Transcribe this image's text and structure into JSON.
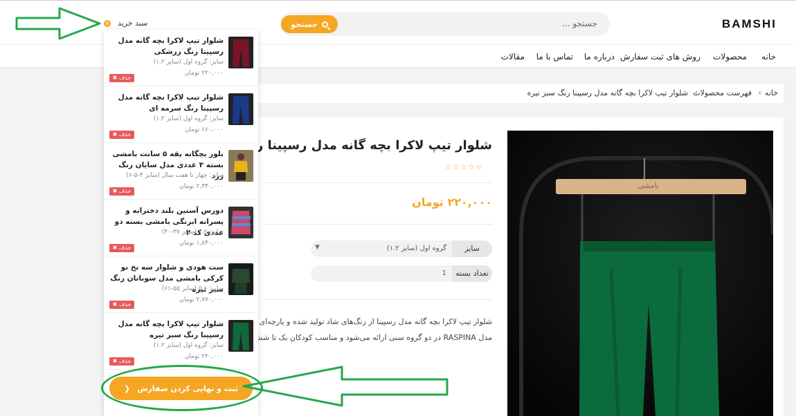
{
  "header": {
    "logo": "BAMSHI",
    "search_placeholder": "جستجو ...",
    "search_button": "جستجو",
    "cart_label": "سبد خرید",
    "cart_count": "6"
  },
  "nav": [
    "خانه",
    "محصولات",
    "روش های ثبت سفارش",
    "درباره ما",
    "تماس با ما",
    "مقالات"
  ],
  "breadcrumb": [
    "خانه",
    "فهرست محصولات",
    "شلوار تیپ لاکرا بچه گانه مدل رسپینا رنگ سبز تیره"
  ],
  "product": {
    "title": "شلوار تیپ لاکرا بچه گانه مدل رسپینا رنگ س",
    "stars": "☆☆☆☆☆",
    "price": "۲۲۰,۰۰۰ تومان",
    "size_label": "سایز",
    "size_value": "گروه اول (سایز ۱.۲)",
    "qty_label": "تعداد بسته",
    "qty_value": "1",
    "desc_line1": "شلوار تیپ لاکرا بچه گانه مدل رسپینا از رنگ‌های شاد تولید شده و پارچه‌ای با",
    "desc_line2": "مدل RASPINA در دو گروه سنی ارائه می‌شود و مناسب کودکان یک تا شش ‌م",
    "hanger_text": "بامشی"
  },
  "cart_items": [
    {
      "title": "شلوار تیپ لاکرا بچه گانه مدل رسپینا رنگ زرشکی",
      "size": "سایز: گروه اول (سایز ۱.۲)",
      "price": "۲۲۰,۰۰۰ تومان",
      "color": "#7a1428"
    },
    {
      "title": "شلوار تیپ لاکرا بچه گانه مدل رسپینا رنگ سرمه ای",
      "size": "سایز: گروه اول (سایز ۱.۲)",
      "price": "۶۶۰,۰۰۰ تومان",
      "color": "#1c3a8a"
    },
    {
      "title": "بلوز بچگانه یقه ۵ سانت بامشی بسته ۳ عددی مدل سایان رنگ زرد",
      "size": "سایز: چهار تا هفت سال (سایز ۴-۵-۶)",
      "price": "۲,۳۴۰,۰۰۰ تومان",
      "color": "#e8b21a"
    },
    {
      "title": "دورس آستین بلند دخترانه و پسرانه ابرنگی بامشی بسته دو عددی کد ۲",
      "size": "سایز: ۱.۲ (سایز ۳۷-۴۰)",
      "price": "۱,۸۴۰,۰۰۰ تومان",
      "color": "#c94a6a"
    },
    {
      "title": "ست هودی و شلوار سه نخ نو کرکی بامشی مدل سوباتان رنگ سبز تیره",
      "size": "سایز: ۵.۶ (سایز ۵۵-۶۱)",
      "price": "۲,۷۷۰,۰۰۰ تومان",
      "color": "#2a4a2e"
    },
    {
      "title": "شلوار تیپ لاکرا بچه گانه مدل رسپینا رنگ سبز تیره",
      "size": "سایز: گروه اول (سایز ۱.۲)",
      "price": "۲۲۰,۰۰۰ تومان",
      "color": "#0f6a3a"
    }
  ],
  "delete_label": "✖ حذف",
  "checkout_label": "ثبت و نهایی کردن سفارش",
  "colors": {
    "accent": "#f5a623",
    "danger": "#e85a5a",
    "annotation": "#22a84a"
  }
}
